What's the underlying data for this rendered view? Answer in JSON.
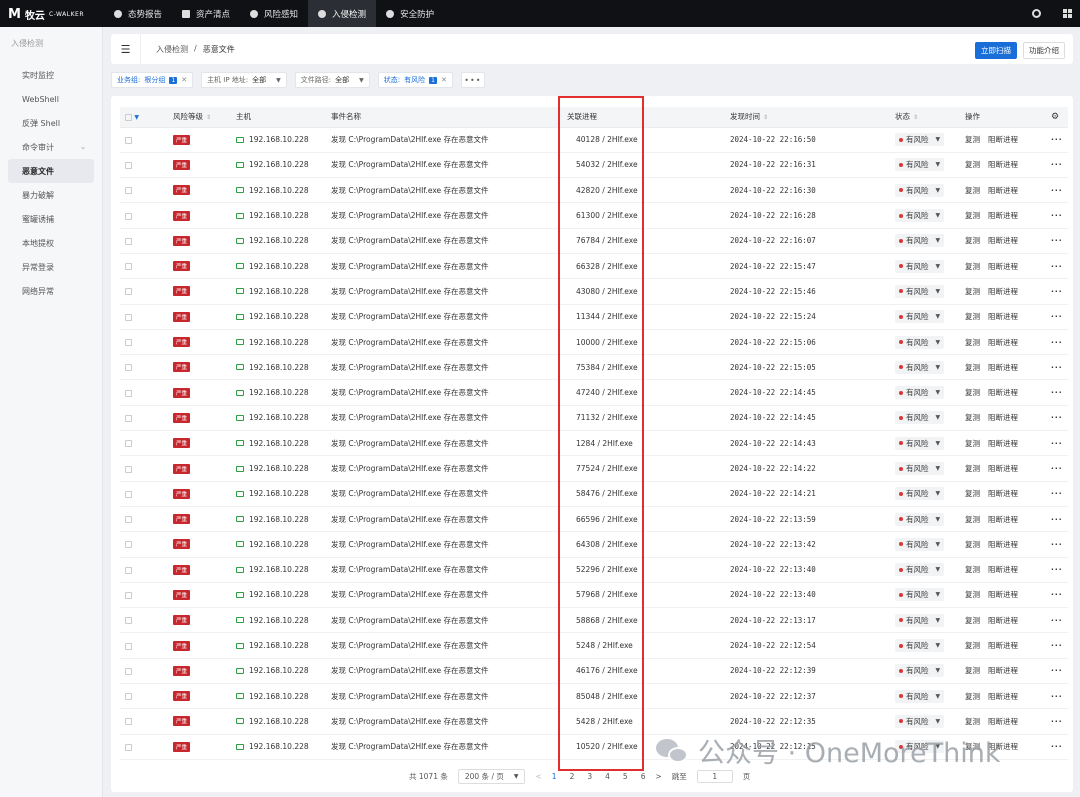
{
  "app": {
    "logo_text": "牧云",
    "logo_sub": "C-WALKER"
  },
  "nav": [
    {
      "label": "态势报告",
      "icon": "compass-icon"
    },
    {
      "label": "资产清点",
      "icon": "briefcase-icon"
    },
    {
      "label": "风险感知",
      "icon": "shield-icon"
    },
    {
      "label": "入侵检测",
      "icon": "globe-icon",
      "active": true
    },
    {
      "label": "安全防护",
      "icon": "shield-check-icon"
    }
  ],
  "sidebar": {
    "head": "入侵检测",
    "items": [
      {
        "label": "实时监控"
      },
      {
        "label": "WebShell"
      },
      {
        "label": "反弹 Shell"
      },
      {
        "label": "命令审计",
        "expandable": true
      },
      {
        "label": "恶意文件",
        "active": true
      },
      {
        "label": "暴力破解"
      },
      {
        "label": "蜜罐诱捕"
      },
      {
        "label": "本地提权"
      },
      {
        "label": "异常登录"
      },
      {
        "label": "网络异常"
      }
    ]
  },
  "breadcrumb": {
    "parent": "入侵检测",
    "sep": "/",
    "current": "恶意文件"
  },
  "header_actions": {
    "scan": "立即扫描",
    "intro": "功能介绍"
  },
  "filters": {
    "group": {
      "label": "业务组:",
      "value": "根分组",
      "count": "1"
    },
    "host_ip": {
      "label": "主机 IP 地址:",
      "value": "全部"
    },
    "file_path": {
      "label": "文件路径:",
      "value": "全部"
    },
    "status": {
      "label": "状态:",
      "value": "有风险",
      "count": "1"
    }
  },
  "columns": {
    "risk": "风险等级",
    "host": "主机",
    "event": "事件名称",
    "process": "关联进程",
    "time": "发现时间",
    "status": "状态",
    "ops": "操作"
  },
  "row_common": {
    "severity": "严重",
    "host": "192.168.10.228",
    "event": "发现 C:\\ProgramData\\2HIf.exe 存在恶意文件",
    "status": "有风险",
    "op_recheck": "复测",
    "op_block": "阻断进程",
    "op_more": "···"
  },
  "rows": [
    {
      "process": "40128 / 2HIf.exe",
      "time": "2024-10-22 22:16:50"
    },
    {
      "process": "54032 / 2HIf.exe",
      "time": "2024-10-22 22:16:31"
    },
    {
      "process": "42820 / 2HIf.exe",
      "time": "2024-10-22 22:16:30"
    },
    {
      "process": "61300 / 2HIf.exe",
      "time": "2024-10-22 22:16:28"
    },
    {
      "process": "76784 / 2HIf.exe",
      "time": "2024-10-22 22:16:07"
    },
    {
      "process": "66328 / 2HIf.exe",
      "time": "2024-10-22 22:15:47"
    },
    {
      "process": "43080 / 2HIf.exe",
      "time": "2024-10-22 22:15:46"
    },
    {
      "process": "11344 / 2HIf.exe",
      "time": "2024-10-22 22:15:24"
    },
    {
      "process": "10000 / 2HIf.exe",
      "time": "2024-10-22 22:15:06"
    },
    {
      "process": "75384 / 2HIf.exe",
      "time": "2024-10-22 22:15:05"
    },
    {
      "process": "47240 / 2HIf.exe",
      "time": "2024-10-22 22:14:45"
    },
    {
      "process": "71132 / 2HIf.exe",
      "time": "2024-10-22 22:14:45"
    },
    {
      "process": "1284 / 2HIf.exe",
      "time": "2024-10-22 22:14:43"
    },
    {
      "process": "77524 / 2HIf.exe",
      "time": "2024-10-22 22:14:22"
    },
    {
      "process": "58476 / 2HIf.exe",
      "time": "2024-10-22 22:14:21"
    },
    {
      "process": "66596 / 2HIf.exe",
      "time": "2024-10-22 22:13:59"
    },
    {
      "process": "64308 / 2HIf.exe",
      "time": "2024-10-22 22:13:42"
    },
    {
      "process": "52296 / 2HIf.exe",
      "time": "2024-10-22 22:13:40"
    },
    {
      "process": "57968 / 2HIf.exe",
      "time": "2024-10-22 22:13:40"
    },
    {
      "process": "58868 / 2HIf.exe",
      "time": "2024-10-22 22:13:17"
    },
    {
      "process": "5248 / 2HIf.exe",
      "time": "2024-10-22 22:12:54"
    },
    {
      "process": "46176 / 2HIf.exe",
      "time": "2024-10-22 22:12:39"
    },
    {
      "process": "85048 / 2HIf.exe",
      "time": "2024-10-22 22:12:37"
    },
    {
      "process": "5428 / 2HIf.exe",
      "time": "2024-10-22 22:12:35"
    },
    {
      "process": "10520 / 2HIf.exe",
      "time": "2024-10-22 22:12:15"
    }
  ],
  "pagination": {
    "total": "共 1071 条",
    "page_size": "200 条 / 页",
    "prev": "<",
    "pages": [
      "1",
      "2",
      "3",
      "4",
      "5",
      "6"
    ],
    "current_page": "1",
    "next": ">",
    "jump_label": "跳至",
    "jump_value": "1",
    "jump_suffix": "页"
  },
  "watermark": "公众号 · OneMoreThink",
  "colors": {
    "primary": "#1a6ed8",
    "danger": "#c8282d",
    "highlight": "#e12e2e",
    "topbar": "#0f1115"
  }
}
